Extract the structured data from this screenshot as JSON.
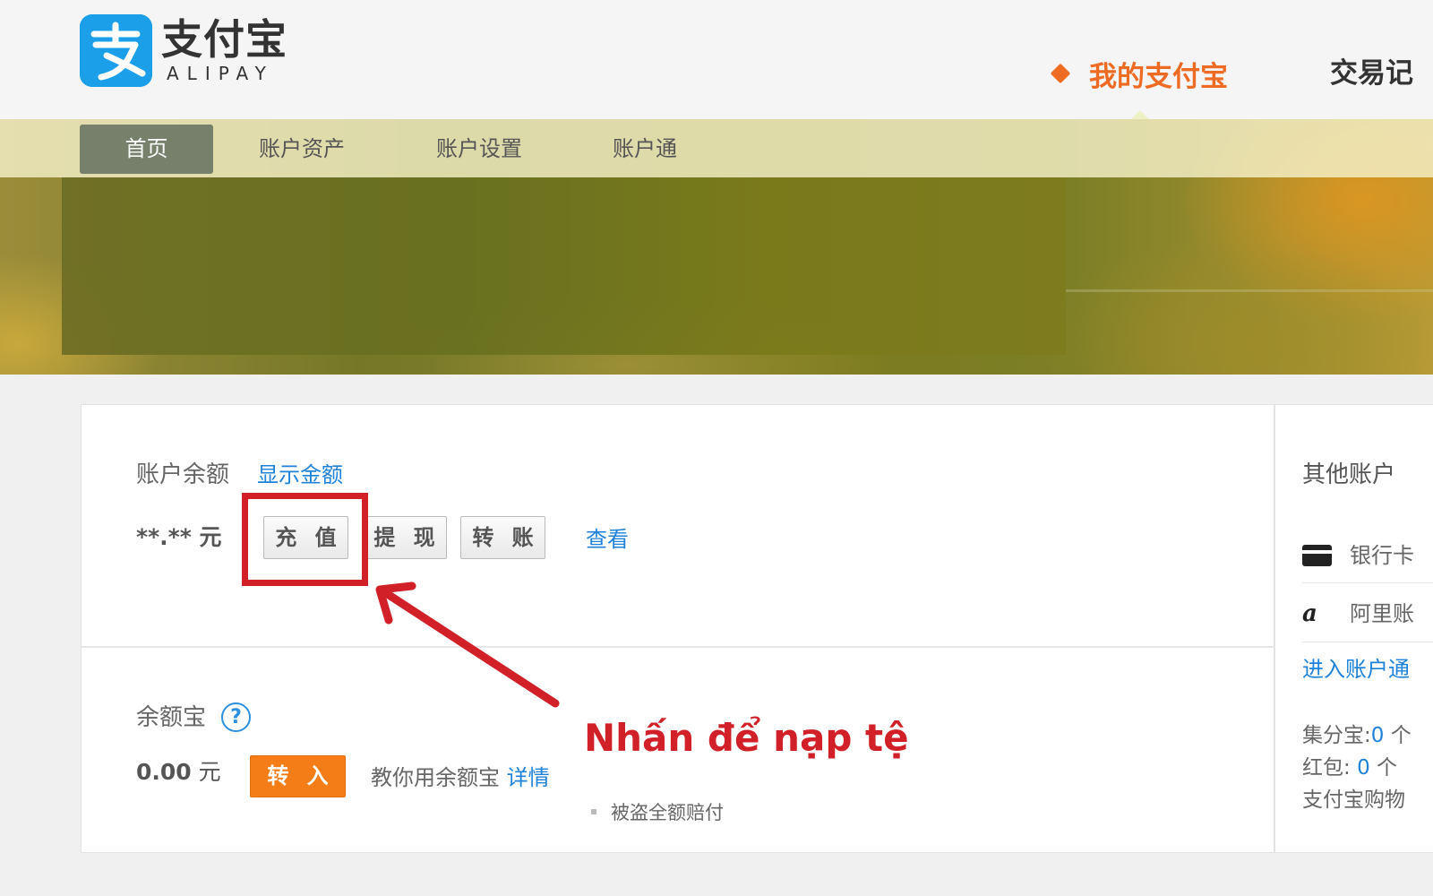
{
  "header": {
    "logo_cn": "支付宝",
    "logo_en": "ALIPAY",
    "nav_active": "我的支付宝",
    "nav_next": "交易记"
  },
  "subnav": {
    "items": [
      "首页",
      "账户资产",
      "账户设置",
      "账户通"
    ]
  },
  "balance": {
    "label": "账户余额",
    "show_link": "显示金额",
    "amount": "**.** 元",
    "buttons": [
      "充 值",
      "提 现",
      "转 账"
    ],
    "view_link": "查看"
  },
  "yuebao": {
    "label": "余额宝",
    "help": "?",
    "amount_value": "0.00",
    "amount_unit": "元",
    "transfer_in": "转 入",
    "teach_text": "教你用余额宝",
    "detail_link": "详情",
    "theft_text": "被盗全额赔付"
  },
  "side": {
    "title": "其他账户",
    "bank_card": "银行卡",
    "ali_item": "阿里账",
    "ali_icon_char": "a",
    "enter_link": "进入账户通",
    "points_label": "集分宝:",
    "points_value": "0",
    "points_unit": "个",
    "hongbao_label": "红包:",
    "hongbao_value": "0",
    "hongbao_unit": "个",
    "shopping_label": "支付宝购物"
  },
  "annotation": {
    "text": "Nhấn để nạp tệ"
  },
  "colors": {
    "accent_orange": "#ee6b24",
    "link_blue": "#1f82d8",
    "annotation_red": "#d12027",
    "logo_blue": "#1a9fe8"
  }
}
